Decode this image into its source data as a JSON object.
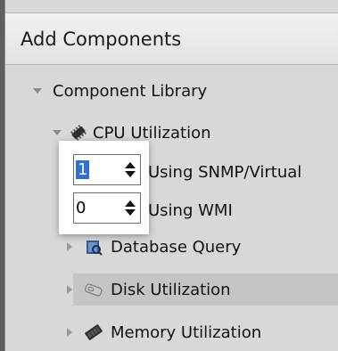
{
  "header": {
    "title": "Add Components"
  },
  "tree": {
    "root_label": "Component Library",
    "cpu_label": "CPU Utilization",
    "cpu_children": [
      {
        "label": "Using SNMP/Virtual",
        "count": "1"
      },
      {
        "label": "Using WMI",
        "count": "0"
      }
    ],
    "items": [
      {
        "label": "Database Query"
      },
      {
        "label": "Disk Utilization"
      },
      {
        "label": "Memory Utilization"
      }
    ]
  },
  "colors": {
    "selection": "#2f6fd6",
    "header_bg": "#eaeaea",
    "panel_bg": "#d8d8d8"
  }
}
